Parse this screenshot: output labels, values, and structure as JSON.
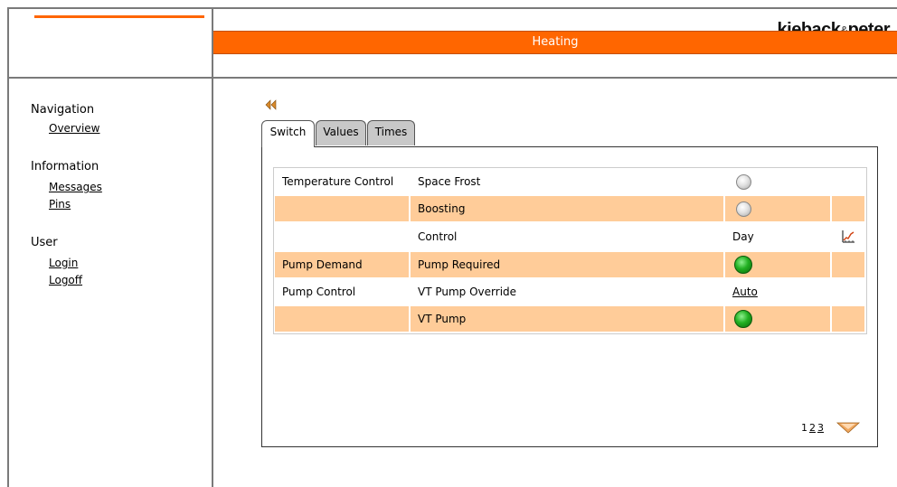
{
  "logo": {
    "text": "kieback",
    "amp": "&",
    "text2": "peter"
  },
  "header": {
    "title": "Heating"
  },
  "sidebar": {
    "sections": [
      {
        "title": "Navigation",
        "links": [
          "Overview"
        ]
      },
      {
        "title": "Information",
        "links": [
          "Messages",
          "Pins"
        ]
      },
      {
        "title": "User",
        "links": [
          "Login",
          "Logoff"
        ]
      }
    ]
  },
  "tabs": [
    "Switch",
    "Values",
    "Times"
  ],
  "active_tab": "Switch",
  "table": {
    "rows": [
      {
        "group": "Temperature Control",
        "name": "Space Frost",
        "value": "",
        "indicator": "grey"
      },
      {
        "group": "",
        "name": "Boosting",
        "value": "",
        "indicator": "grey"
      },
      {
        "group": "",
        "name": "Control",
        "value": "Day",
        "indicator": "",
        "action_icon": "graph-icon"
      },
      {
        "group": "Pump Demand",
        "name": "Pump Required",
        "value": "",
        "indicator": "green"
      },
      {
        "group": "Pump Control",
        "name": "VT Pump Override",
        "value": "Auto",
        "indicator": "",
        "value_link": true
      },
      {
        "group": "",
        "name": "VT Pump",
        "value": "",
        "indicator": "green"
      }
    ]
  },
  "pager": {
    "pages": [
      "1",
      "2",
      "3"
    ],
    "current": "1"
  },
  "colors": {
    "accent": "#ff6600",
    "row_alt": "#ffcc99",
    "lamp_green": "#22b022",
    "lamp_grey": "#d8d8d8"
  }
}
